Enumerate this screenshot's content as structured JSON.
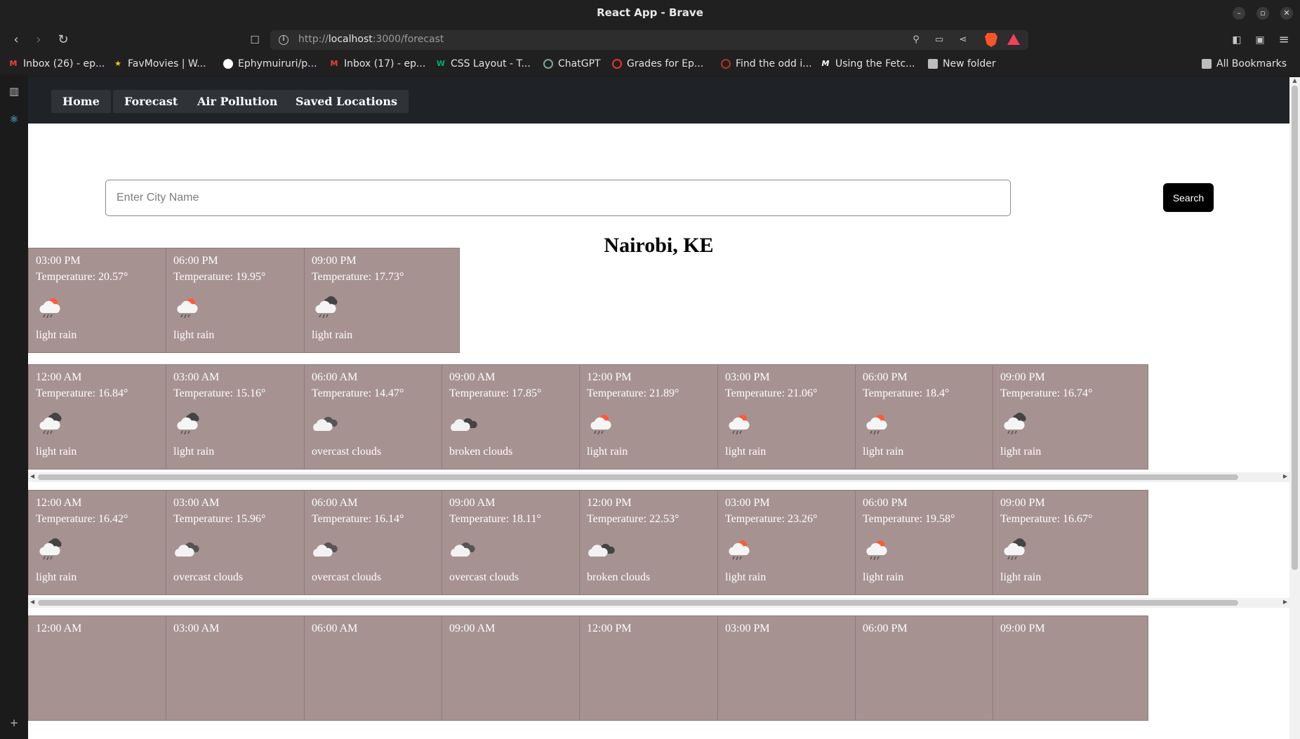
{
  "window": {
    "title": "React App - Brave",
    "minimize_icon": "minimize-icon",
    "maximize_icon": "maximize-icon",
    "close_icon": "close-icon"
  },
  "toolbar": {
    "url_prefix": "http://",
    "url_host": "localhost",
    "url_rest": ":3000/forecast"
  },
  "bookmarks": [
    {
      "label": "Inbox (26) - ep...",
      "icon": "gmail-icon",
      "color": "#ea4335"
    },
    {
      "label": "FavMovies | W...",
      "icon": "star-icon",
      "color": "#f5c518"
    },
    {
      "label": "Ephymuiruri/p...",
      "icon": "github-icon",
      "color": "#ffffff"
    },
    {
      "label": "Inbox (17) - ep...",
      "icon": "gmail-icon",
      "color": "#ea4335"
    },
    {
      "label": "CSS Layout - T...",
      "icon": "w3-icon",
      "color": "#04aa6d"
    },
    {
      "label": "ChatGPT",
      "icon": "chatgpt-icon",
      "color": "#74aa9c"
    },
    {
      "label": "Grades for Ep...",
      "icon": "grades-icon",
      "color": "#e0392b"
    },
    {
      "label": "Find the odd i...",
      "icon": "codewars-icon",
      "color": "#b1361e"
    },
    {
      "label": "Using the Fetc...",
      "icon": "mdn-icon",
      "color": "#ffffff"
    },
    {
      "label": "New folder",
      "icon": "folder-icon",
      "color": "#bdbdbd"
    }
  ],
  "all_bookmarks": "All Bookmarks",
  "app": {
    "nav": [
      "Home",
      "Forecast",
      "Air Pollution",
      "Saved Locations"
    ],
    "search_placeholder": "Enter City Name",
    "search_button": "Search",
    "city": "Nairobi, KE"
  },
  "days": [
    [
      {
        "time": "03:00 PM",
        "temp": "Temperature: 20.57°",
        "icon": "sun-rain-icon",
        "desc": "light rain"
      },
      {
        "time": "06:00 PM",
        "temp": "Temperature: 19.95°",
        "icon": "sun-rain-icon",
        "desc": "light rain"
      },
      {
        "time": "09:00 PM",
        "temp": "Temperature: 17.73°",
        "icon": "night-rain-icon",
        "desc": "light rain"
      }
    ],
    [
      {
        "time": "12:00 AM",
        "temp": "Temperature: 16.84°",
        "icon": "night-rain-icon",
        "desc": "light rain"
      },
      {
        "time": "03:00 AM",
        "temp": "Temperature: 15.16°",
        "icon": "night-rain-icon",
        "desc": "light rain"
      },
      {
        "time": "06:00 AM",
        "temp": "Temperature: 14.47°",
        "icon": "overcast-clouds-icon",
        "desc": "overcast clouds"
      },
      {
        "time": "09:00 AM",
        "temp": "Temperature: 17.85°",
        "icon": "broken-clouds-icon",
        "desc": "broken clouds"
      },
      {
        "time": "12:00 PM",
        "temp": "Temperature: 21.89°",
        "icon": "sun-rain-icon",
        "desc": "light rain"
      },
      {
        "time": "03:00 PM",
        "temp": "Temperature: 21.06°",
        "icon": "sun-rain-icon",
        "desc": "light rain"
      },
      {
        "time": "06:00 PM",
        "temp": "Temperature: 18.4°",
        "icon": "sun-rain-icon",
        "desc": "light rain"
      },
      {
        "time": "09:00 PM",
        "temp": "Temperature: 16.74°",
        "icon": "night-rain-icon",
        "desc": "light rain"
      }
    ],
    [
      {
        "time": "12:00 AM",
        "temp": "Temperature: 16.42°",
        "icon": "night-rain-icon",
        "desc": "light rain"
      },
      {
        "time": "03:00 AM",
        "temp": "Temperature: 15.96°",
        "icon": "overcast-clouds-icon",
        "desc": "overcast clouds"
      },
      {
        "time": "06:00 AM",
        "temp": "Temperature: 16.14°",
        "icon": "overcast-clouds-icon",
        "desc": "overcast clouds"
      },
      {
        "time": "09:00 AM",
        "temp": "Temperature: 18.11°",
        "icon": "overcast-clouds-icon",
        "desc": "overcast clouds"
      },
      {
        "time": "12:00 PM",
        "temp": "Temperature: 22.53°",
        "icon": "broken-clouds-icon",
        "desc": "broken clouds"
      },
      {
        "time": "03:00 PM",
        "temp": "Temperature: 23.26°",
        "icon": "sun-rain-icon",
        "desc": "light rain"
      },
      {
        "time": "06:00 PM",
        "temp": "Temperature: 19.58°",
        "icon": "sun-rain-icon",
        "desc": "light rain"
      },
      {
        "time": "09:00 PM",
        "temp": "Temperature: 16.67°",
        "icon": "night-rain-icon",
        "desc": "light rain"
      }
    ],
    [
      {
        "time": "12:00 AM"
      },
      {
        "time": "03:00 AM"
      },
      {
        "time": "06:00 AM"
      },
      {
        "time": "09:00 AM"
      },
      {
        "time": "12:00 PM"
      },
      {
        "time": "03:00 PM"
      },
      {
        "time": "06:00 PM"
      },
      {
        "time": "09:00 PM"
      }
    ]
  ],
  "colors": {
    "card_bg": "#a79292",
    "nav_bg": "#1f2327",
    "nav_button_bg": "#2f3337"
  }
}
